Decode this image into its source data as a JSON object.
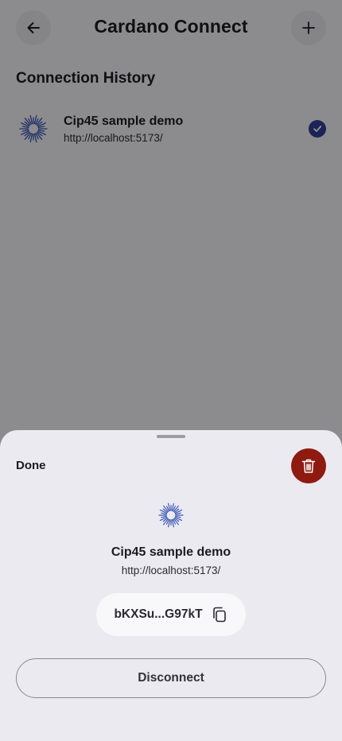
{
  "header": {
    "title": "Cardano Connect",
    "back_icon": "arrow-left-icon",
    "add_icon": "plus-icon"
  },
  "history": {
    "heading": "Connection History",
    "items": [
      {
        "name": "Cip45 sample demo",
        "url": "http://localhost:5173/",
        "selected": true
      }
    ]
  },
  "sheet": {
    "done_label": "Done",
    "delete_icon": "trash-icon",
    "app_name": "Cip45 sample demo",
    "app_url": "http://localhost:5173/",
    "peer_id": "bKXSu...G97kT",
    "copy_icon": "copy-icon",
    "disconnect_label": "Disconnect"
  },
  "colors": {
    "accent": "#2f3f95",
    "danger": "#8e1a10",
    "sheet_bg": "#ebeaf0",
    "logo_blue": "#3a55b4"
  }
}
